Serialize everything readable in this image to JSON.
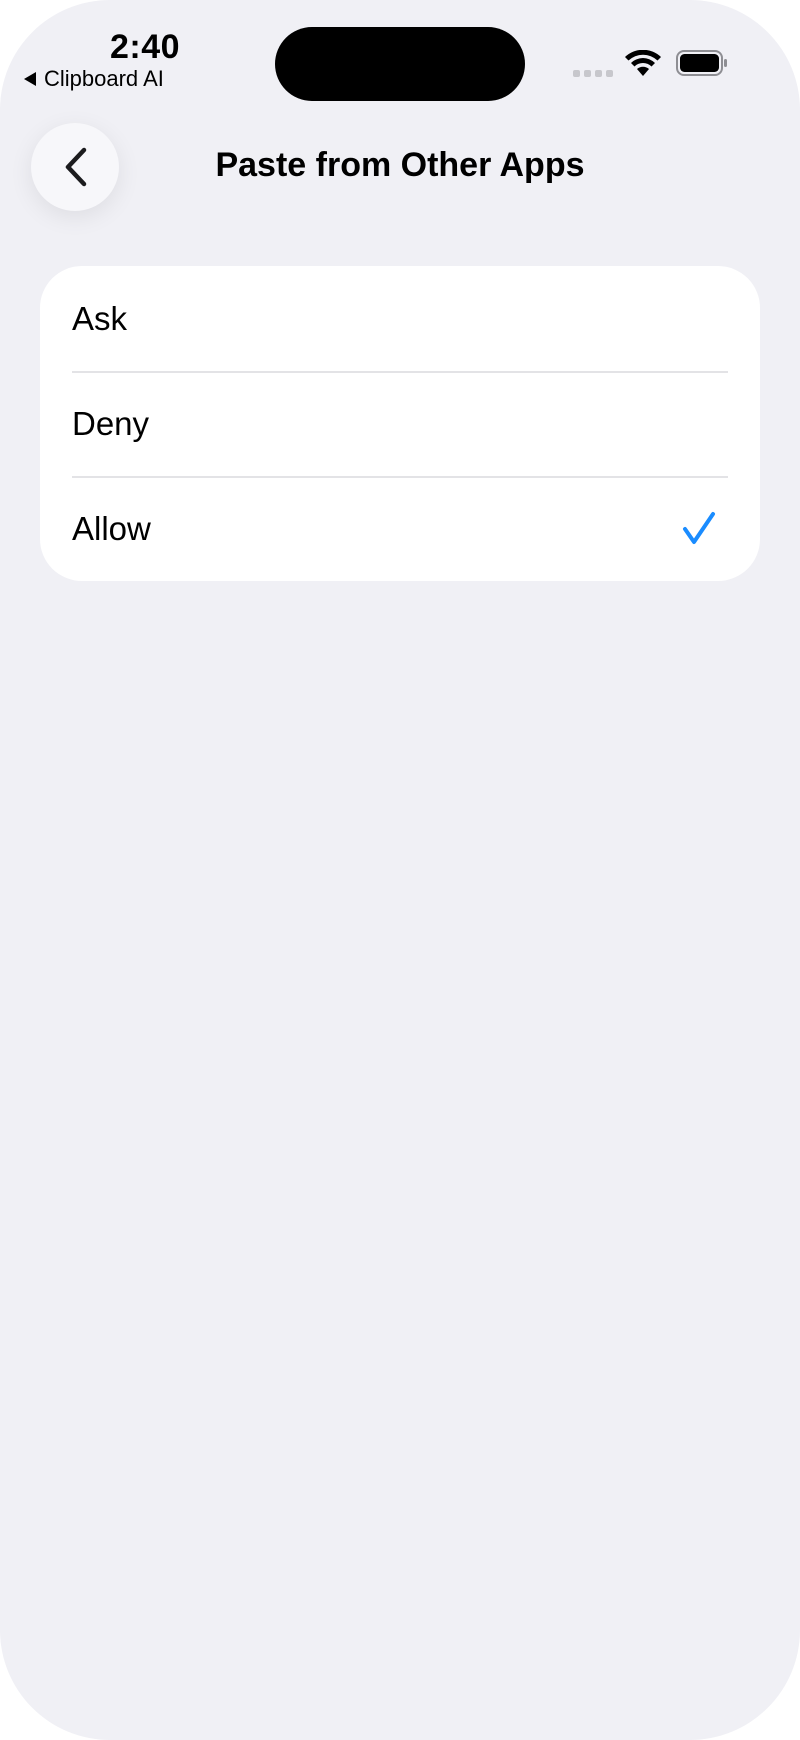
{
  "status_bar": {
    "time": "2:40",
    "back_app_label": "Clipboard AI"
  },
  "nav": {
    "title": "Paste from Other Apps",
    "back_icon": "chevron-left-icon"
  },
  "options": [
    {
      "label": "Ask",
      "selected": false
    },
    {
      "label": "Deny",
      "selected": false
    },
    {
      "label": "Allow",
      "selected": true
    }
  ],
  "colors": {
    "accent": "#1a8cff",
    "background": "#f0f0f5",
    "card": "#ffffff"
  }
}
